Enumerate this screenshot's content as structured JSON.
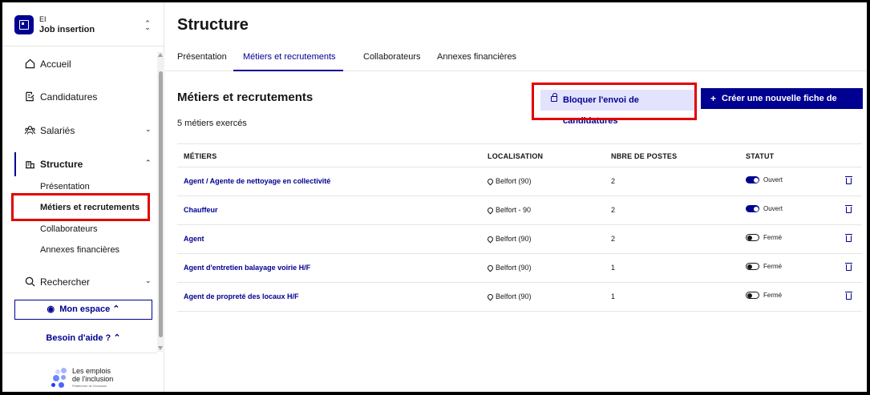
{
  "org": {
    "type": "EI",
    "name": "Job insertion"
  },
  "sidebar": {
    "items": [
      {
        "label": "Accueil"
      },
      {
        "label": "Candidatures"
      },
      {
        "label": "Salariés"
      },
      {
        "label": "Structure"
      },
      {
        "label": "Rechercher"
      }
    ],
    "structure_sub": [
      {
        "label": "Présentation"
      },
      {
        "label": "Métiers et recrutements"
      },
      {
        "label": "Collaborateurs"
      },
      {
        "label": "Annexes financières"
      }
    ],
    "mon_espace": "Mon espace",
    "help": "Besoin d'aide ?",
    "brand_line1": "Les emplois",
    "brand_line2": "de l'inclusion",
    "brand_sub": "Plateforme de l'inclusion"
  },
  "page": {
    "title": "Structure",
    "tabs": [
      {
        "label": "Présentation"
      },
      {
        "label": "Métiers et recrutements"
      },
      {
        "label": "Collaborateurs"
      },
      {
        "label": "Annexes financières"
      }
    ]
  },
  "section": {
    "title": "Métiers et recrutements",
    "count": "5 métiers exercés",
    "block_button": "Bloquer l'envoi de candidatures",
    "new_button": "Créer une nouvelle fiche de poste"
  },
  "table": {
    "headers": [
      "MÉTIERS",
      "LOCALISATION",
      "NBRE DE POSTES",
      "STATUT"
    ],
    "rows": [
      {
        "metier": "Agent / Agente de nettoyage en collectivité",
        "loc": "Belfort (90)",
        "nb": "2",
        "status": "Ouvert",
        "open": true
      },
      {
        "metier": "Chauffeur",
        "loc": "Belfort - 90",
        "nb": "2",
        "status": "Ouvert",
        "open": true
      },
      {
        "metier": "Agent",
        "loc": "Belfort (90)",
        "nb": "2",
        "status": "Fermé",
        "open": false
      },
      {
        "metier": "Agent d'entretien balayage voirie H/F",
        "loc": "Belfort (90)",
        "nb": "1",
        "status": "Fermé",
        "open": false
      },
      {
        "metier": "Agent de propreté des locaux H/F",
        "loc": "Belfort (90)",
        "nb": "1",
        "status": "Fermé",
        "open": false
      }
    ]
  },
  "colors": {
    "primary": "#000091",
    "highlight": "#e30000",
    "secondary_bg": "#e3e3fd"
  }
}
